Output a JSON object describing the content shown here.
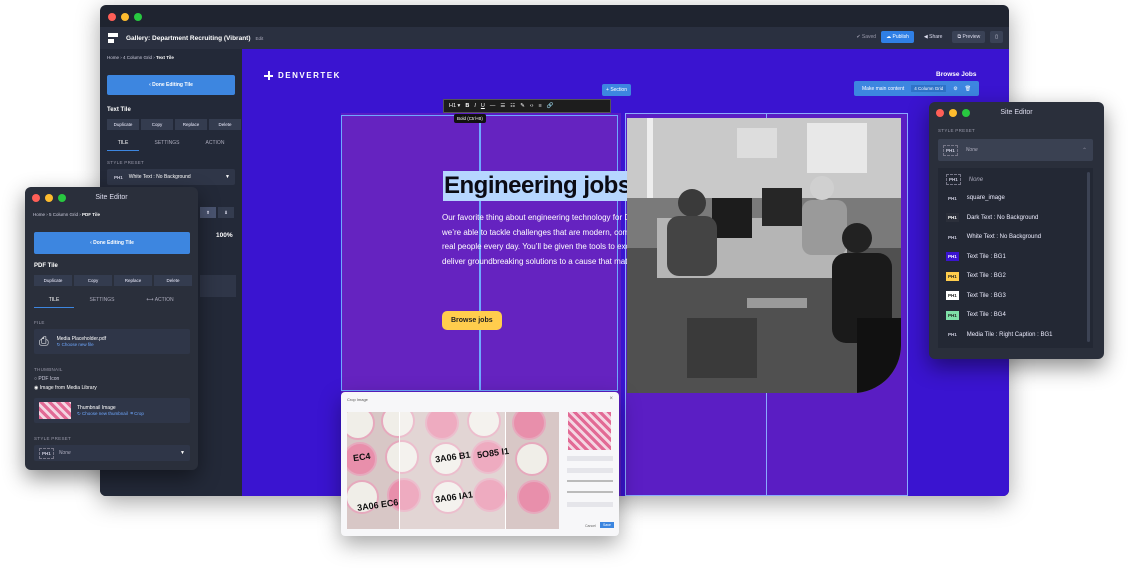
{
  "app": {
    "title": "Gallery: Department Recruiting (Vibrant)",
    "edit_label": "Edit",
    "saved": "Saved",
    "publish": "Publish",
    "share": "Share",
    "preview": "Preview"
  },
  "sidebar": {
    "breadcrumb": [
      "Home",
      "4 Column Grid",
      "Text Tile"
    ],
    "done_editing": "Done Editing Tile",
    "tile_heading": "Text Tile",
    "actions": [
      "Duplicate",
      "Copy",
      "Replace",
      "Delete"
    ],
    "tabs": [
      "TILE",
      "SETTINGS",
      "ACTION"
    ],
    "style_preset_label": "STYLE PRESET",
    "style_preset_value": "White Text : No Background",
    "zoom": "100%"
  },
  "canvas": {
    "brand": "DENVERTEK",
    "section_button": "Section",
    "browse_jobs_top": "Browse Jobs",
    "make_main_content": "Make main content",
    "grid_label": "4 Column Grid",
    "format_tooltip": "Bold (Ctrl+B)",
    "format_h1": "H1",
    "headline": "Engineering jobs",
    "paragraph": "Our favorite thing about engineering technology for DenverTek is that we’re able to tackle challenges that are modern, complex, and that impact real people every day. You’ll be given the tools to excel at your craft and deliver groundbreaking solutions to a cause that matters.",
    "cta": "Browse jobs"
  },
  "left_editor": {
    "title": "Site Editor",
    "breadcrumb": [
      "Home",
      "5 Column Grid",
      "PDF Tile"
    ],
    "done_editing": "Done Editing Tile",
    "tile_heading": "PDF Tile",
    "actions": [
      "Duplicate",
      "Copy",
      "Replace",
      "Delete"
    ],
    "tabs": [
      "TILE",
      "SETTINGS",
      "ACTION"
    ],
    "file_label": "FILE",
    "file_name": "Media Placeholder.pdf",
    "choose_file": "Choose new file",
    "thumbnail_label": "THUMBNAIL",
    "radio_pdf_icon": "PDF Icon",
    "radio_media_library": "Image from Media Library",
    "thumb_name": "Thumbnail Image",
    "choose_thumb": "Choose new thumbnail",
    "crop": "Crop",
    "style_preset_label": "STYLE PRESET",
    "style_preset_value": "None"
  },
  "right_editor": {
    "title": "Site Editor",
    "style_preset_label": "STYLE PRESET",
    "selected": "None",
    "options": [
      {
        "label": "None",
        "badge": "PH1",
        "color": ""
      },
      {
        "label": "square_image",
        "badge": "PH1",
        "color": ""
      },
      {
        "label": "Dark Text : No Background",
        "badge": "PH1",
        "color": "#2b2f3a"
      },
      {
        "label": "White Text : No Background",
        "badge": "PH1",
        "color": ""
      },
      {
        "label": "Text Tile : BG1",
        "badge": "PH1",
        "color": "#3a14d0"
      },
      {
        "label": "Text Tile : BG2",
        "badge": "PH1",
        "color": "#ffcd4d"
      },
      {
        "label": "Text Tile : BG3",
        "badge": "PH1",
        "color": "#ffffff"
      },
      {
        "label": "Text Tile : BG4",
        "badge": "PH1",
        "color": "#7fe0a8"
      },
      {
        "label": "Media Tile : Right Caption : BG1",
        "badge": "PH1",
        "color": ""
      }
    ]
  },
  "crop_modal": {
    "title": "Crop Image",
    "cancel": "Cancel",
    "save": "Save",
    "writing": [
      "3A06 EC6",
      "3A06 B1",
      "5O85 I1",
      "3A06 IA1",
      "EC4"
    ]
  },
  "colors": {
    "canvas_bg": "#3a14d0",
    "accent": "#3d86e0",
    "cta": "#ffcd4d"
  }
}
